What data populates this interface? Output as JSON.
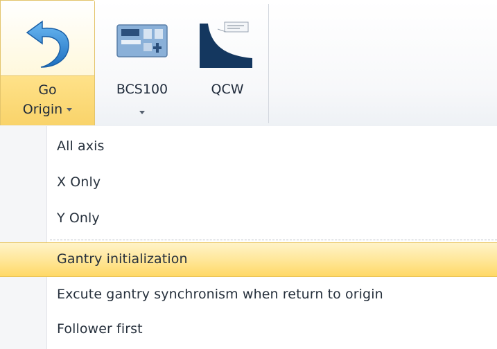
{
  "ribbon": {
    "go_origin": {
      "label_line1": "Go",
      "label_line2": "Origin",
      "icon": "undo-arrow-icon"
    },
    "bcs100": {
      "label": "BCS100",
      "icon": "controller-panel-icon"
    },
    "qcw": {
      "label": "QCW",
      "icon": "qcw-curve-icon"
    }
  },
  "menu": {
    "items": [
      {
        "label": "All axis"
      },
      {
        "label": "X Only"
      },
      {
        "label": "Y Only"
      },
      {
        "label": "Gantry initialization"
      },
      {
        "label": "Excute gantry synchronism when return to origin"
      },
      {
        "label": "Follower first"
      }
    ],
    "highlighted_index": 3
  },
  "colors": {
    "highlight": "#ffe79a",
    "accent_blue": "#1f78c8",
    "text": "#26303c"
  }
}
